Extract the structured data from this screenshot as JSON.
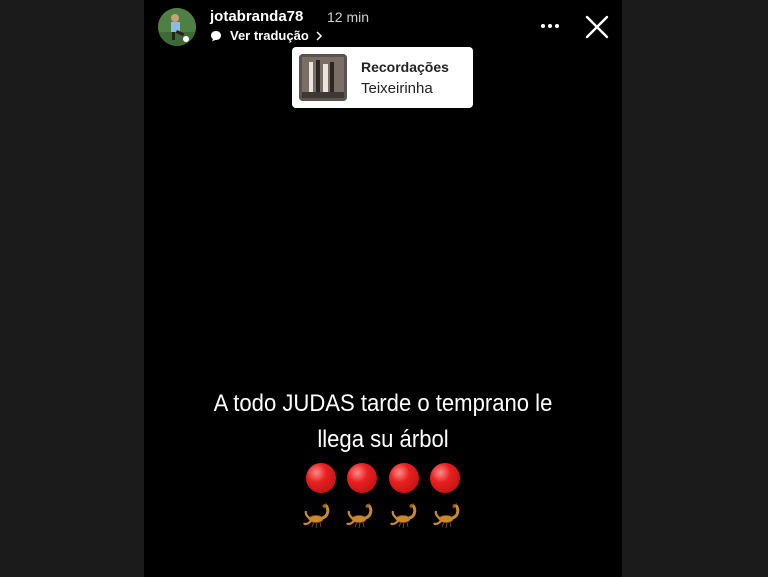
{
  "story": {
    "username": "jotabranda78",
    "time": "12 min",
    "translate_label": "Ver tradução",
    "icons": {
      "more": "more-dots-icon",
      "close": "close-icon",
      "translate": "speech-bubble-icon",
      "chevron": "chevron-right-icon"
    }
  },
  "music": {
    "title": "Recordações",
    "artist": "Teixeirinha"
  },
  "caption": {
    "line1": "A  todo JUDAS tarde o temprano le",
    "line2": "llega su árbol"
  },
  "emojis": {
    "red_circles": 4,
    "scorpions": 4
  },
  "colors": {
    "background": "#000000",
    "text": "#ffffff",
    "sticker_bg": "#ffffff"
  }
}
